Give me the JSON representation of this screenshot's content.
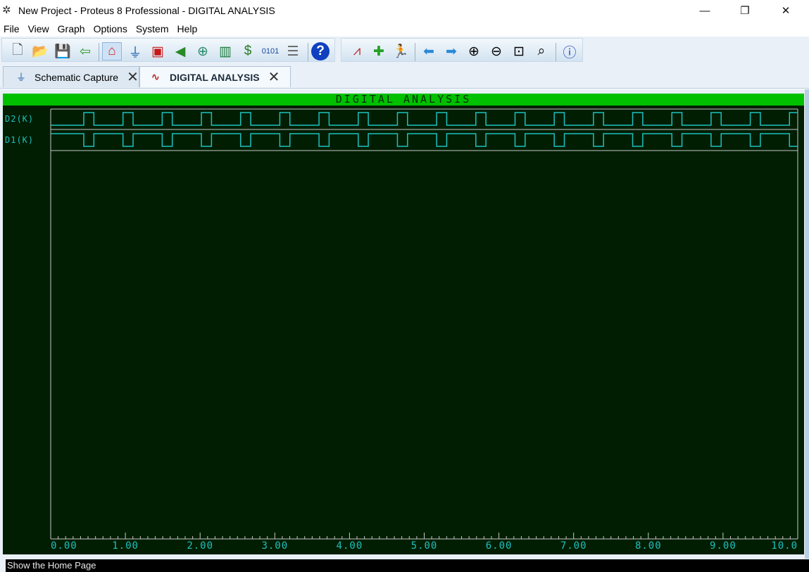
{
  "window": {
    "title": "New Project - Proteus 8 Professional - DIGITAL ANALYSIS",
    "minimize": "—",
    "restore": "❐",
    "close": "✕"
  },
  "menu": [
    "File",
    "View",
    "Graph",
    "Options",
    "System",
    "Help"
  ],
  "toolbar": {
    "icons": [
      "new-file",
      "open-folder",
      "save",
      "import-exit",
      "home-page",
      "schematic-capture",
      "pcb-layout",
      "3d-visualizer",
      "gerber-viewer",
      "design-explorer",
      "bill-of-materials",
      "source-code",
      "project-notes",
      "help",
      "edit-graph",
      "add-trace",
      "simulate-graph",
      "back",
      "forward",
      "zoom-in",
      "zoom-out",
      "zoom-all",
      "zoom-area",
      "graph-log"
    ]
  },
  "tabs": [
    {
      "label": "Schematic Capture",
      "close": "✕"
    },
    {
      "label": "DIGITAL ANALYSIS",
      "close": "✕"
    }
  ],
  "graph": {
    "title": "DIGITAL ANALYSIS"
  },
  "chart_data": {
    "type": "line",
    "title": "DIGITAL ANALYSIS",
    "xlim": [
      0,
      10
    ],
    "x_ticks": [
      "0.00",
      "1.00",
      "2.00",
      "3.00",
      "4.00",
      "5.00",
      "6.00",
      "7.00",
      "8.00",
      "9.00",
      "10.0"
    ],
    "minor_ticks_per_unit": 10,
    "series": [
      {
        "name": "D2(K)",
        "idle": 0,
        "pulse_first_edge": 0.443,
        "pulse_width": 0.135,
        "period": 0.5248,
        "color": "#1ec0c0"
      },
      {
        "name": "D1(K)",
        "idle": 1,
        "pulse_first_edge": 0.443,
        "pulse_width": 0.135,
        "period": 0.5248,
        "color": "#1ec0c0"
      }
    ],
    "background": "#011e02",
    "header_color": "#00c000"
  },
  "status": {
    "text": "Show the Home Page"
  }
}
